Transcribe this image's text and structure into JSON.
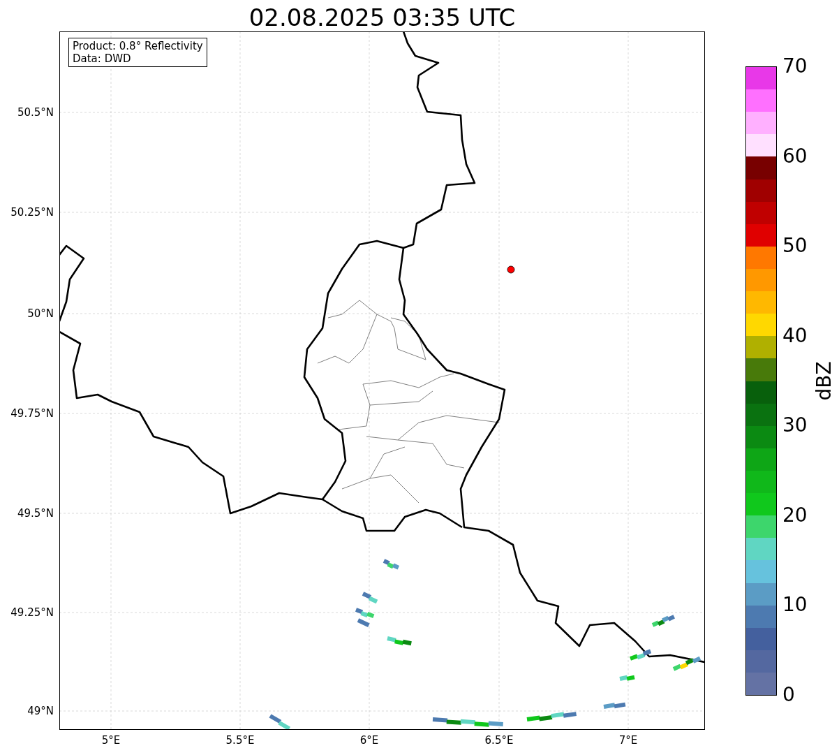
{
  "title": "02.08.2025 03:35 UTC",
  "info_box": [
    "Product: 0.8° Reflectivity",
    "Data: DWD"
  ],
  "map": {
    "xticks": [
      "5°E",
      "5.5°E",
      "6°E",
      "6.5°E",
      "7°E"
    ],
    "yticks": [
      "50.5°N",
      "50.25°N",
      "50°N",
      "49.75°N",
      "49.5°N",
      "49.25°N",
      "49°N"
    ]
  },
  "colorbar": {
    "label": "dBZ",
    "ticks": [
      "70",
      "60",
      "50",
      "40",
      "30",
      "20",
      "10",
      "0"
    ],
    "bands": [
      {
        "color": "#e838e8"
      },
      {
        "color": "#ff70ff"
      },
      {
        "color": "#ffb0ff"
      },
      {
        "color": "#ffe0ff"
      },
      {
        "color": "#780000"
      },
      {
        "color": "#a00000"
      },
      {
        "color": "#c00000"
      },
      {
        "color": "#e00000"
      },
      {
        "color": "#ff7800"
      },
      {
        "color": "#ff9800"
      },
      {
        "color": "#ffb800"
      },
      {
        "color": "#ffd800"
      },
      {
        "color": "#b0b000"
      },
      {
        "color": "#487a0a"
      },
      {
        "color": "#08600c"
      },
      {
        "color": "#0a7210"
      },
      {
        "color": "#0b8a12"
      },
      {
        "color": "#0ea616"
      },
      {
        "color": "#10b81a"
      },
      {
        "color": "#10c81c"
      },
      {
        "color": "#3dd66c"
      },
      {
        "color": "#60d6c2"
      },
      {
        "color": "#66c2dd"
      },
      {
        "color": "#5b9cc5"
      },
      {
        "color": "#4d7ab0"
      },
      {
        "color": "#44609e"
      },
      {
        "color": "#5468a0"
      },
      {
        "color": "#6472a4"
      }
    ]
  }
}
